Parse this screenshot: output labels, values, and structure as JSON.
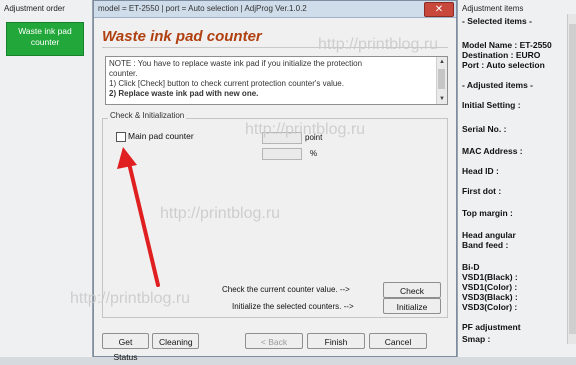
{
  "left_pane": {
    "title": "Adjustment order",
    "selected_item": "Waste ink pad counter"
  },
  "window": {
    "title": "model = ET-2550 | port = Auto selection | AdjProg Ver.1.0.2",
    "close_glyph": "✕",
    "heading": "Waste ink pad counter",
    "note_lines": [
      "NOTE : You have to replace waste ink pad if you initialize the protection",
      "counter.",
      "1) Click [Check] button to check current protection counter's value.",
      "2) Replace waste ink pad with new one."
    ],
    "group_title": "Check & Initialization",
    "main_pad_label": "Main pad counter",
    "point_unit": "point",
    "percent_unit": "%",
    "check_text": "Check the current counter value. -->",
    "init_text": "Initialize the selected counters. -->",
    "check_button": "Check",
    "initialize_button": "Initialize",
    "get_status_button": "Get Status",
    "cleaning_button": "Cleaning",
    "back_button": "< Back",
    "finish_button": "Finish",
    "cancel_button": "Cancel"
  },
  "right_pane": {
    "title": "Adjustment items",
    "lines": [
      "- Selected items -",
      "Model Name : ET-2550",
      "Destination : EURO",
      "Port : Auto selection",
      "- Adjusted items -",
      "Initial Setting :",
      "Serial No. :",
      "MAC Address :",
      "Head ID :",
      "First dot :",
      "Top margin :",
      "Head angular",
      " Band feed :",
      "Bi-D",
      " VSD1(Black) :",
      " VSD1(Color) :",
      " VSD3(Black) :",
      " VSD3(Color) :",
      "PF adjustment",
      "Smap :"
    ]
  },
  "watermark": "http://printblog.ru",
  "colors": {
    "heading": "#b04010",
    "selected_item_bg": "#22a83a",
    "arrow": "#e02020"
  }
}
